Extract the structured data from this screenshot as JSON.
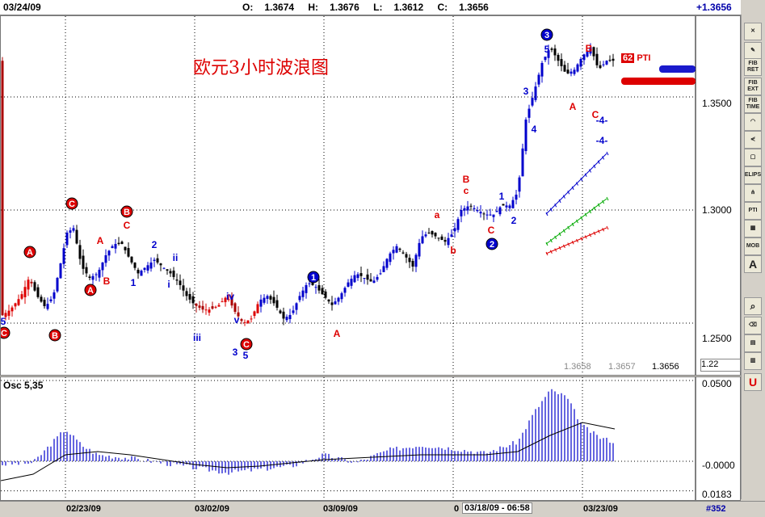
{
  "header": {
    "date": "03/24/09",
    "open_label": "O:",
    "open": "1.3674",
    "high_label": "H:",
    "high": "1.3676",
    "low_label": "L:",
    "low": "1.3612",
    "close_label": "C:",
    "close": "1.3656",
    "change": "+1.3656"
  },
  "main_chart": {
    "title": "欧元3小时波浪图",
    "price_ticks": [
      "1.3500",
      "1.3000",
      "1.2500"
    ],
    "bottom_left_box": "1.22",
    "readouts": [
      "1.3658",
      "1.3657",
      "1.3656"
    ],
    "pti_number": "62",
    "pti_label": "PTI",
    "colors": {
      "up": "#0000cc",
      "down": "#000000",
      "red": "#dd0000",
      "green": "#00aa00",
      "accent_blue": "#1a1acc"
    }
  },
  "wave_labels": {
    "red": [
      "A",
      "A",
      "B",
      "C",
      "B",
      "C",
      "A",
      "B",
      "C",
      "A",
      "a",
      "b",
      "B",
      "c",
      "C",
      "A",
      "B",
      "C"
    ],
    "blue": [
      "5",
      "1",
      "2",
      "ii",
      "i",
      "iii",
      "iv",
      "v",
      "3",
      "5",
      "1",
      "2",
      "3",
      "4",
      "5",
      "1",
      "2",
      "-4-",
      "-4-"
    ],
    "circled_red": [
      "C",
      "A",
      "A",
      "B",
      "C",
      "B",
      "C"
    ],
    "circled_blue": [
      "1",
      "2",
      "3"
    ]
  },
  "oscillator": {
    "label": "Osc 5,35",
    "ticks": [
      "0.0500",
      "-0.0000",
      "0.0183"
    ]
  },
  "x_axis": {
    "labels": [
      "02/23/09",
      "03/02/09",
      "03/09/09",
      "03/18/09 - 06:58",
      "03/23/09"
    ],
    "left_marker": "0"
  },
  "footer": {
    "bar_id": "#352"
  },
  "toolbar": {
    "items": [
      "fib-ret",
      "fib-ext",
      "fib-time",
      "fib-fan",
      "fan-lines",
      "square",
      "ellipse",
      "pitchfork",
      "pti",
      "grid",
      "mob",
      "text",
      "zoom",
      "eraser",
      "layers",
      "stack",
      "magnet"
    ],
    "labels": {
      "fib_ret": "FIB RET",
      "fib_ext": "FIB EXT",
      "fib_time": "FIB TIME",
      "ellipse": "ELIPS",
      "pti": "PTI",
      "mob": "MOB",
      "text": "A",
      "magnet": "U"
    }
  },
  "chart_data": {
    "type": "candlestick",
    "instrument": "EUR/USD 3h",
    "x_labels": [
      "02/23/09",
      "03/02/09",
      "03/09/09",
      "03/18/09",
      "03/23/09"
    ],
    "ylim": [
      1.22,
      1.38
    ],
    "y_ticks": [
      1.25,
      1.3,
      1.35
    ],
    "close_path": [
      [
        0,
        1.253
      ],
      [
        12,
        1.256
      ],
      [
        25,
        1.262
      ],
      [
        35,
        1.27
      ],
      [
        45,
        1.262
      ],
      [
        55,
        1.257
      ],
      [
        65,
        1.262
      ],
      [
        75,
        1.278
      ],
      [
        82,
        1.29
      ],
      [
        90,
        1.292
      ],
      [
        100,
        1.275
      ],
      [
        110,
        1.27
      ],
      [
        120,
        1.272
      ],
      [
        130,
        1.28
      ],
      [
        140,
        1.285
      ],
      [
        150,
        1.285
      ],
      [
        160,
        1.278
      ],
      [
        170,
        1.272
      ],
      [
        180,
        1.275
      ],
      [
        190,
        1.278
      ],
      [
        200,
        1.275
      ],
      [
        210,
        1.272
      ],
      [
        220,
        1.268
      ],
      [
        230,
        1.262
      ],
      [
        240,
        1.258
      ],
      [
        250,
        1.256
      ],
      [
        260,
        1.256
      ],
      [
        270,
        1.258
      ],
      [
        280,
        1.262
      ],
      [
        290,
        1.255
      ],
      [
        300,
        1.25
      ],
      [
        310,
        1.252
      ],
      [
        320,
        1.26
      ],
      [
        330,
        1.262
      ],
      [
        340,
        1.258
      ],
      [
        350,
        1.252
      ],
      [
        360,
        1.254
      ],
      [
        370,
        1.262
      ],
      [
        380,
        1.268
      ],
      [
        390,
        1.266
      ],
      [
        400,
        1.262
      ],
      [
        410,
        1.258
      ],
      [
        420,
        1.262
      ],
      [
        430,
        1.268
      ],
      [
        440,
        1.272
      ],
      [
        450,
        1.27
      ],
      [
        460,
        1.268
      ],
      [
        470,
        1.272
      ],
      [
        480,
        1.28
      ],
      [
        490,
        1.284
      ],
      [
        500,
        1.28
      ],
      [
        510,
        1.275
      ],
      [
        520,
        1.288
      ],
      [
        530,
        1.29
      ],
      [
        540,
        1.288
      ],
      [
        550,
        1.286
      ],
      [
        560,
        1.29
      ],
      [
        570,
        1.3
      ],
      [
        580,
        1.302
      ],
      [
        590,
        1.3
      ],
      [
        600,
        1.298
      ],
      [
        610,
        1.298
      ],
      [
        620,
        1.302
      ],
      [
        630,
        1.302
      ],
      [
        640,
        1.308
      ],
      [
        650,
        1.34
      ],
      [
        660,
        1.352
      ],
      [
        670,
        1.365
      ],
      [
        680,
        1.372
      ],
      [
        690,
        1.366
      ],
      [
        700,
        1.36
      ],
      [
        710,
        1.362
      ],
      [
        720,
        1.368
      ],
      [
        730,
        1.372
      ],
      [
        740,
        1.362
      ],
      [
        750,
        1.366
      ],
      [
        760,
        1.366
      ]
    ],
    "oscillator": {
      "name": "Osc 5,35",
      "ylim": [
        -0.0183,
        0.05
      ],
      "histogram_path": [
        [
          0,
          -0.002
        ],
        [
          40,
          -0.001
        ],
        [
          80,
          0.02
        ],
        [
          100,
          0.01
        ],
        [
          120,
          0.004
        ],
        [
          160,
          0.002
        ],
        [
          200,
          -0.001
        ],
        [
          240,
          -0.004
        ],
        [
          280,
          -0.007
        ],
        [
          320,
          -0.005
        ],
        [
          360,
          -0.003
        ],
        [
          400,
          0.004
        ],
        [
          440,
          -0.001
        ],
        [
          480,
          0.007
        ],
        [
          520,
          0.01
        ],
        [
          560,
          0.008
        ],
        [
          600,
          0.005
        ],
        [
          640,
          0.012
        ],
        [
          660,
          0.03
        ],
        [
          680,
          0.044
        ],
        [
          700,
          0.04
        ],
        [
          720,
          0.022
        ],
        [
          740,
          0.015
        ],
        [
          760,
          0.012
        ]
      ],
      "signal_path": [
        [
          0,
          -0.012
        ],
        [
          40,
          -0.008
        ],
        [
          80,
          0.004
        ],
        [
          120,
          0.006
        ],
        [
          160,
          0.004
        ],
        [
          200,
          0.001
        ],
        [
          240,
          -0.002
        ],
        [
          280,
          -0.004
        ],
        [
          320,
          -0.003
        ],
        [
          360,
          -0.001
        ],
        [
          400,
          0.001
        ],
        [
          440,
          0.002
        ],
        [
          480,
          0.003
        ],
        [
          520,
          0.004
        ],
        [
          560,
          0.004
        ],
        [
          600,
          0.004
        ],
        [
          640,
          0.006
        ],
        [
          680,
          0.016
        ],
        [
          720,
          0.024
        ],
        [
          760,
          0.02
        ]
      ]
    }
  }
}
